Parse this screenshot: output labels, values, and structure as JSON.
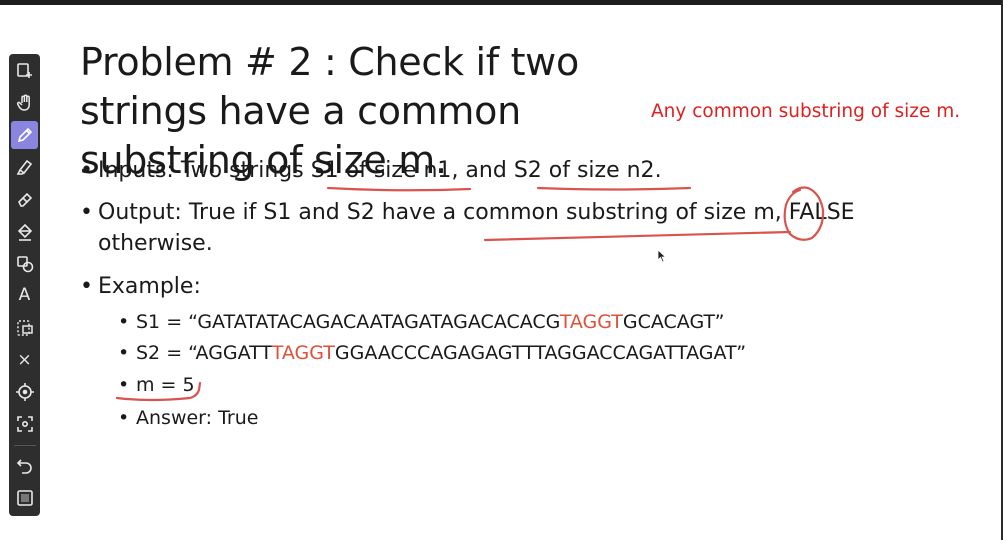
{
  "toolbar": {
    "tools": [
      {
        "name": "new-slide-icon"
      },
      {
        "name": "hand-icon"
      },
      {
        "name": "pen-icon",
        "active": true
      },
      {
        "name": "highlighter-icon"
      },
      {
        "name": "eraser-icon"
      },
      {
        "name": "fill-icon"
      },
      {
        "name": "shapes-icon"
      },
      {
        "name": "text-icon",
        "glyph": "A"
      },
      {
        "name": "select-icon"
      },
      {
        "name": "clear-icon",
        "glyph": "×"
      },
      {
        "name": "laser-pointer-icon"
      },
      {
        "name": "screenshot-icon"
      },
      {
        "name": "undo-icon"
      },
      {
        "name": "whiteboard-icon"
      }
    ],
    "active_color": "#8a86e0"
  },
  "slide": {
    "title": "Problem # 2 : Check if two strings have a common substring of size m.",
    "note": "Any common substring of size m.",
    "inputs": {
      "prefix": "Inputs: Two strings ",
      "s1": "S1 of size n1",
      "mid": ", and ",
      "s2": "S2 of size n2",
      "suffix": "."
    },
    "output": {
      "line1_prefix": "Output: True if S1 and S2 have a common substring of size ",
      "m": "m",
      "line1_suffix": ", FALSE",
      "line2": "otherwise."
    },
    "example_label": "Example:",
    "s1": {
      "prefix": "S1 = “GATATATACAGACAATAGATAGACACACG",
      "highlight": "TAGGT",
      "suffix": "GCACAGT”"
    },
    "s2": {
      "prefix": "S2 = “AGGATT",
      "highlight": "TAGGT",
      "suffix": "GGAACCCAGAGAGTTTAGGACCAGATTAGAT”"
    },
    "m_line": "m = 5",
    "answer": "Answer: True"
  },
  "colors": {
    "annotation": "#e02020",
    "ink": "#d9534f",
    "highlight": "#e0503a"
  }
}
